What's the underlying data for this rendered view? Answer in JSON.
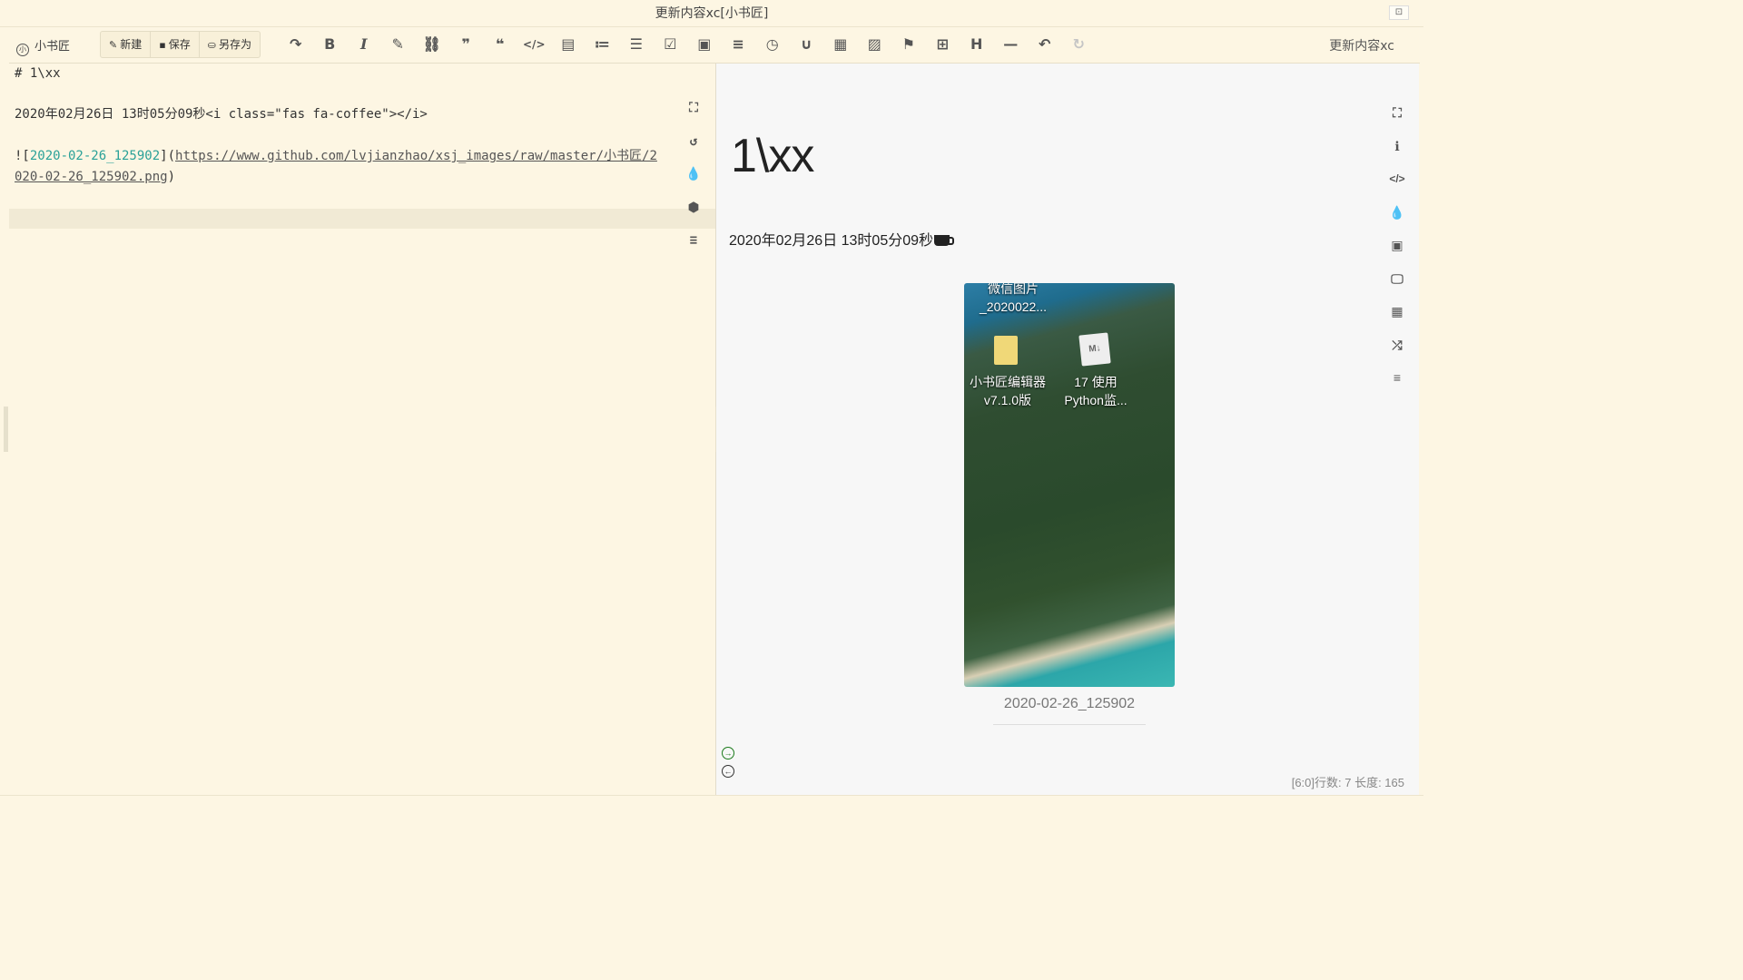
{
  "window": {
    "title": "更新内容xc[小书匠]",
    "restore_glyph": "⊡"
  },
  "toolbar": {
    "logo_badge": "小",
    "logo_text": "小书匠",
    "buttons": [
      {
        "icon": "✎",
        "label": "新建"
      },
      {
        "icon": "▪",
        "label": "保存"
      },
      {
        "icon": "⛀",
        "label": "另存为"
      }
    ],
    "tools": [
      "↷",
      "B",
      "I",
      "✎",
      "⛓",
      "❞",
      "❝",
      "</>",
      "▤",
      "≔",
      "☰",
      "☑",
      "▣",
      "≡",
      "◷",
      "∪",
      "▦",
      "▨",
      "⚑",
      "⊞",
      "H",
      "—",
      "↶",
      "↻"
    ],
    "document_name": "更新内容xc"
  },
  "editor": {
    "lines": [
      "# 1\\xx",
      "2020年02月26日 13时05分09秒<i class=\"fas fa-coffee\"></i>"
    ],
    "image_prefix": "![",
    "image_alt": "2020-02-26_125902",
    "image_mid": "](",
    "image_url_part1": "https://www.github.com/lvjianzhao/xsj_images/raw/master/小书匠/2",
    "image_url_part2": "020-02-26_125902.png",
    "image_suffix": ")",
    "side_icons": [
      "⛶",
      "↺",
      "💧",
      "⬢",
      "≡"
    ]
  },
  "preview": {
    "heading": "1\\xx",
    "datetime": "2020年02月26日  13时05分09秒",
    "image": {
      "desktop_items": [
        "微信图片_2020022...",
        "小书匠编辑器 v7.1.0版",
        "17 使用 Python监..."
      ],
      "md_icon_label": "M↓",
      "caption": "2020-02-26_125902"
    },
    "side_icons": [
      "⛶",
      "ℹ",
      "</>",
      "💧",
      "▣",
      "🖵",
      "▦",
      "⤮",
      "≡"
    ],
    "nav_next": "→",
    "nav_prev": "←",
    "status": "[6:0]行数: 7 长度: 165"
  },
  "colors": {
    "background": "#fdf6e3",
    "preview_bg": "#f7f7f7",
    "link": "#2aa198"
  }
}
